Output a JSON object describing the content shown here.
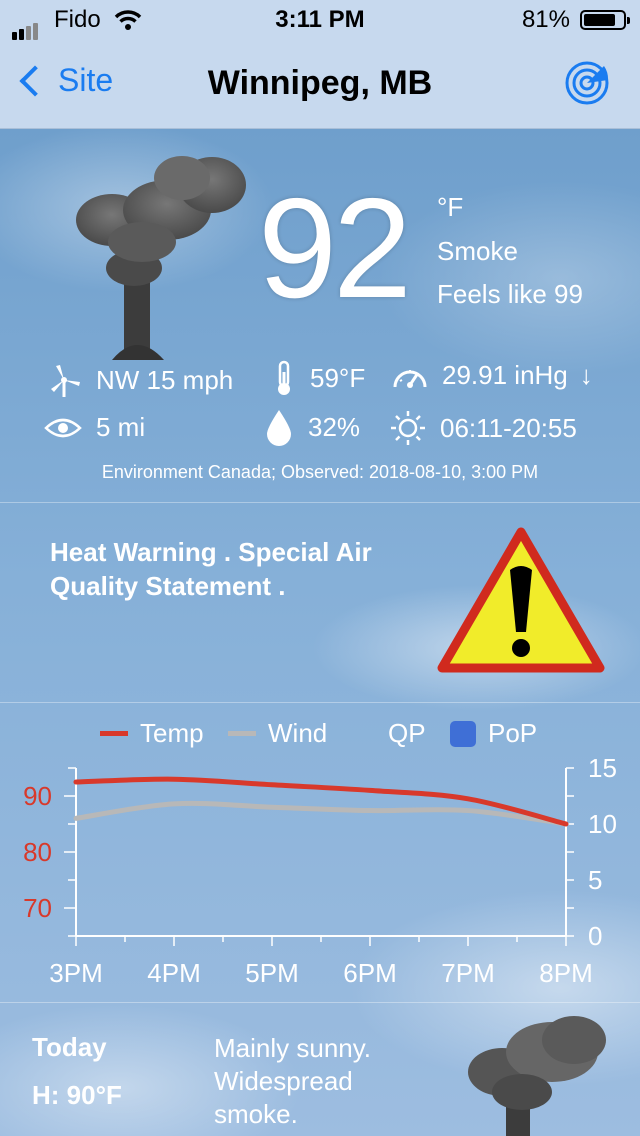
{
  "status_bar": {
    "carrier": "Fido",
    "time": "3:11 PM",
    "battery_percent": "81%",
    "battery_level": 0.81
  },
  "nav": {
    "back_label": "Site",
    "title": "Winnipeg, MB",
    "accent_color": "#1a7cf0"
  },
  "current": {
    "temperature": "92",
    "unit": "°F",
    "condition": "Smoke",
    "feels_like": "Feels like 99",
    "wind": "NW 15 mph",
    "dewpoint": "59°F",
    "pressure": "29.91 inHg",
    "pressure_trend": "↓",
    "visibility": "5 mi",
    "humidity": "32%",
    "sun": "06:11-20:55",
    "observed": "Environment Canada; Observed: 2018-08-10, 3:00 PM"
  },
  "warning": {
    "text": "Heat Warning . Special Air Quality Statement ."
  },
  "chart_data": {
    "type": "line",
    "legend": [
      "Temp",
      "Wind",
      "QP",
      "PoP"
    ],
    "x": [
      "3PM",
      "4PM",
      "5PM",
      "6PM",
      "7PM",
      "8PM"
    ],
    "series": [
      {
        "name": "Temp",
        "color": "#d8392b",
        "axis": "left",
        "values": [
          92.5,
          93,
          92,
          91,
          89.5,
          85
        ]
      },
      {
        "name": "Wind",
        "color": "#b8b8b8",
        "axis": "right",
        "values": [
          10.5,
          11.8,
          11.5,
          11.2,
          11.2,
          10
        ]
      }
    ],
    "left_axis": {
      "ticks": [
        "70",
        "80",
        "90"
      ],
      "ylim": [
        65,
        95
      ],
      "color": "#d8392b"
    },
    "right_axis": {
      "ticks": [
        "0",
        "5",
        "10",
        "15"
      ],
      "ylim": [
        0,
        15
      ]
    }
  },
  "forecast": {
    "day": "Today",
    "high": "H: 90°F",
    "description": "Mainly sunny. Widespread smoke."
  }
}
